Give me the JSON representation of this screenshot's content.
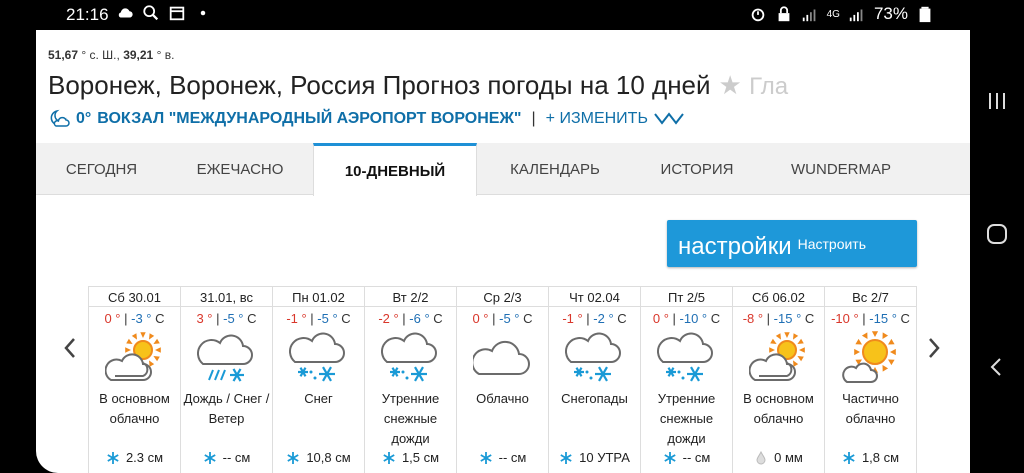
{
  "status_bar": {
    "time": "21:16",
    "network": "4G",
    "battery": "73%"
  },
  "header": {
    "lat_value": "51,67",
    "lat_unit": "° с. Ш.,",
    "lon_value": "39,21",
    "lon_unit": "° в.",
    "title": "Воронеж, Воронеж, Россия Прогноз погоды на 10 дней",
    "title_tail": "Гла",
    "station_temp": "0°",
    "station_name": "ВОКЗАЛ \"МЕЖДУНАРОДНЫЙ АЭРОПОРТ ВОРОНЕЖ\"",
    "station_sep": "|",
    "change_label": "+ ИЗМЕНИТЬ"
  },
  "tabs": [
    {
      "label": "СЕГОДНЯ"
    },
    {
      "label": "ЕЖЕЧАСНО"
    },
    {
      "label": "10-ДНЕВНЫЙ"
    },
    {
      "label": "КАЛЕНДАРЬ"
    },
    {
      "label": "ИСТОРИЯ"
    },
    {
      "label": "WUNDERMAP"
    }
  ],
  "settings": {
    "big_label": "настройки",
    "small_label": "Настроить"
  },
  "colors": {
    "accent": "#1e98d9",
    "temp_high": "#d9372b",
    "temp_low": "#1f6fb4",
    "station_link": "#0f6fa8"
  },
  "forecast": [
    {
      "date": "Сб 30.01",
      "hi": "0 °",
      "lo": "-3 °",
      "unit": "C",
      "icon": "partly-cloudy-icon",
      "cond": "В основном облачно",
      "precip_icon": "snowflake-icon",
      "precip": "2.3 см"
    },
    {
      "date": "31.01, вс",
      "hi": "3 °",
      "lo": "-5 °",
      "unit": "C",
      "icon": "rain-snow-icon",
      "cond": "Дождь / Снег / Ветер",
      "precip_icon": "snowflake-icon",
      "precip": "-- см"
    },
    {
      "date": "Пн 01.02",
      "hi": "-1 °",
      "lo": "-5 °",
      "unit": "C",
      "icon": "snow-icon",
      "cond": "Снег",
      "precip_icon": "snowflake-icon",
      "precip": "10,8 см"
    },
    {
      "date": "Вт 2/2",
      "hi": "-2 °",
      "lo": "-6 °",
      "unit": "C",
      "icon": "snow-icon",
      "cond": "Утренние снежные дожди",
      "precip_icon": "snowflake-icon",
      "precip": "1,5 см"
    },
    {
      "date": "Ср 2/3",
      "hi": "0 °",
      "lo": "-5 °",
      "unit": "C",
      "icon": "cloudy-icon",
      "cond": "Облачно",
      "precip_icon": "snowflake-icon",
      "precip": "-- см"
    },
    {
      "date": "Чт 02.04",
      "hi": "-1 °",
      "lo": "-2 °",
      "unit": "C",
      "icon": "snow-icon",
      "cond": "Снегопады",
      "precip_icon": "snowflake-icon",
      "precip": "10 УТРА"
    },
    {
      "date": "Пт 2/5",
      "hi": "0 °",
      "lo": "-10 °",
      "unit": "C",
      "icon": "snow-icon",
      "cond": "Утренние снежные дожди",
      "precip_icon": "snowflake-icon",
      "precip": "-- см"
    },
    {
      "date": "Сб 06.02",
      "hi": "-8 °",
      "lo": "-15 °",
      "unit": "C",
      "icon": "partly-cloudy-icon",
      "cond": "В основном облачно",
      "precip_icon": "raindrop-icon",
      "precip": "0 мм"
    },
    {
      "date": "Вс 2/7",
      "hi": "-10 °",
      "lo": "-15 °",
      "unit": "C",
      "icon": "mostly-sunny-icon",
      "cond": "Частично облачно",
      "precip_icon": "snowflake-icon",
      "precip": "1,8 см"
    }
  ]
}
